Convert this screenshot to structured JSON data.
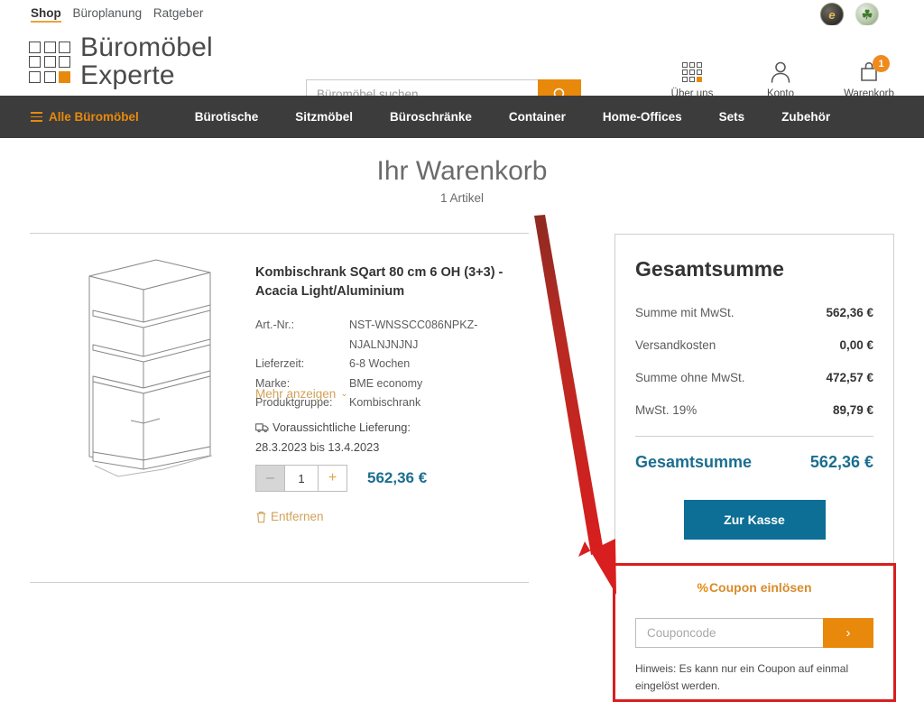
{
  "utilbar": {
    "links": [
      {
        "label": "Shop",
        "active": true
      },
      {
        "label": "Büroplanung",
        "active": false
      },
      {
        "label": "Ratgeber",
        "active": false
      }
    ],
    "seals": [
      {
        "name": "trust-seal-dark",
        "glyph": "e"
      },
      {
        "name": "trust-seal-green",
        "glyph": "☘"
      }
    ]
  },
  "header": {
    "logo": {
      "line1": "Büromöbel",
      "line2": "Experte"
    },
    "search": {
      "placeholder": "Büromöbel suchen...",
      "value": "",
      "icon": "search-icon"
    },
    "icons": [
      {
        "name": "about-us",
        "label": "Über uns",
        "icon": "grid-icon",
        "badge": ""
      },
      {
        "name": "account",
        "label": "Konto",
        "icon": "user-icon",
        "badge": ""
      },
      {
        "name": "cart",
        "label": "Warenkorb",
        "icon": "cart-icon",
        "badge": "1"
      }
    ]
  },
  "nav": {
    "all_label": "Alle Büromöbel",
    "items": [
      "Bürotische",
      "Sitzmöbel",
      "Büroschränke",
      "Container",
      "Home-Offices",
      "Sets",
      "Zubehör"
    ]
  },
  "page": {
    "title": "Ihr Warenkorb",
    "subtitle": "1 Artikel"
  },
  "item": {
    "image_alt": "kombischrank-line-drawing",
    "title": "Kombischrank SQart 80 cm 6 OH (3+3) - Acacia Light/Aluminium",
    "specs": [
      {
        "key": "Art.-Nr.:",
        "value": "NST-WNSSCC086NPKZ-NJALNJNJNJ"
      },
      {
        "key": "Lieferzeit:",
        "value": "6-8 Wochen"
      },
      {
        "key": "Marke:",
        "value": "BME economy"
      },
      {
        "key": "Produktgruppe:",
        "value": "Kombischrank"
      }
    ],
    "more_label": "Mehr anzeigen",
    "more_chevron": "⌄",
    "delivery_label": "Voraussichtliche Lieferung:",
    "delivery_dates": "28.3.2023 bis 13.4.2023",
    "quantity": "1",
    "minus_label": "–",
    "plus_label": "+",
    "price": "562,36 €",
    "remove_label": "Entfernen"
  },
  "summary": {
    "heading": "Gesamtsumme",
    "rows": [
      {
        "label": "Summe mit MwSt.",
        "amount": "562,36 €"
      },
      {
        "label": "Versandkosten",
        "amount": "0,00 €"
      },
      {
        "label": "Summe ohne MwSt.",
        "amount": "472,57 €"
      },
      {
        "label": "MwSt. 19%",
        "amount": "89,79 €"
      }
    ],
    "total_label": "Gesamtsumme",
    "total_amount": "562,36 €",
    "checkout_label": "Zur Kasse"
  },
  "coupon": {
    "title": "Coupon einlösen",
    "percent_glyph": "%",
    "placeholder": "Couponcode",
    "value": "",
    "submit_glyph": "›",
    "note": "Hinweis: Es kann nur ein Coupon auf einmal eingelöst werden."
  },
  "colors": {
    "orange": "#e8890c",
    "teal": "#0d6e96",
    "nav_dark": "#3c3c3c",
    "annotation_red": "#d81e1e",
    "link_gold": "#d2a158"
  }
}
